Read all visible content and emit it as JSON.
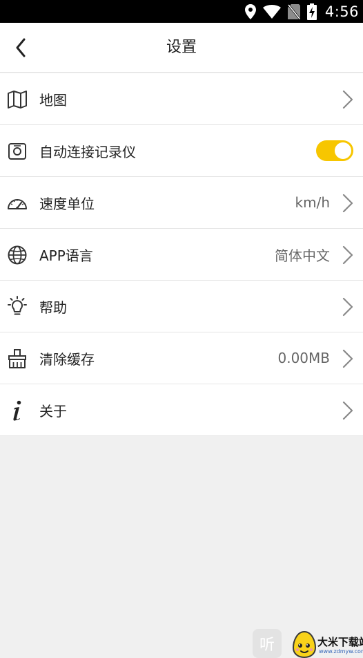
{
  "status_bar": {
    "time": "4:56",
    "icons": [
      "location-pin-icon",
      "wifi-icon",
      "no-sim-icon",
      "battery-charging-icon"
    ]
  },
  "header": {
    "title": "设置",
    "back_icon": "back-arrow-icon"
  },
  "settings": [
    {
      "id": "map",
      "label": "地图",
      "icon": "map-icon",
      "value": "",
      "control": "chevron"
    },
    {
      "id": "auto-connect",
      "label": "自动连接记录仪",
      "icon": "camera-icon",
      "value": "",
      "control": "toggle",
      "toggle_on": true
    },
    {
      "id": "speed-unit",
      "label": "速度单位",
      "icon": "speedometer-icon",
      "value": "km/h",
      "control": "chevron"
    },
    {
      "id": "app-language",
      "label": "APP语言",
      "icon": "globe-icon",
      "value": "简体中文",
      "control": "chevron"
    },
    {
      "id": "help",
      "label": "帮助",
      "icon": "lightbulb-icon",
      "value": "",
      "control": "chevron"
    },
    {
      "id": "clear-cache",
      "label": "清除缓存",
      "icon": "broom-icon",
      "value": "0.00MB",
      "control": "chevron"
    },
    {
      "id": "about",
      "label": "关于",
      "icon": "info-icon",
      "value": "",
      "control": "chevron"
    }
  ],
  "colors": {
    "accent": "#f7c600",
    "status_bar": "#000000",
    "background": "#f0f0f0",
    "row_background": "#ffffff"
  },
  "watermark": {
    "listen_label": "听",
    "brand": "大米下载站",
    "url": "www.zdmyw.com"
  }
}
